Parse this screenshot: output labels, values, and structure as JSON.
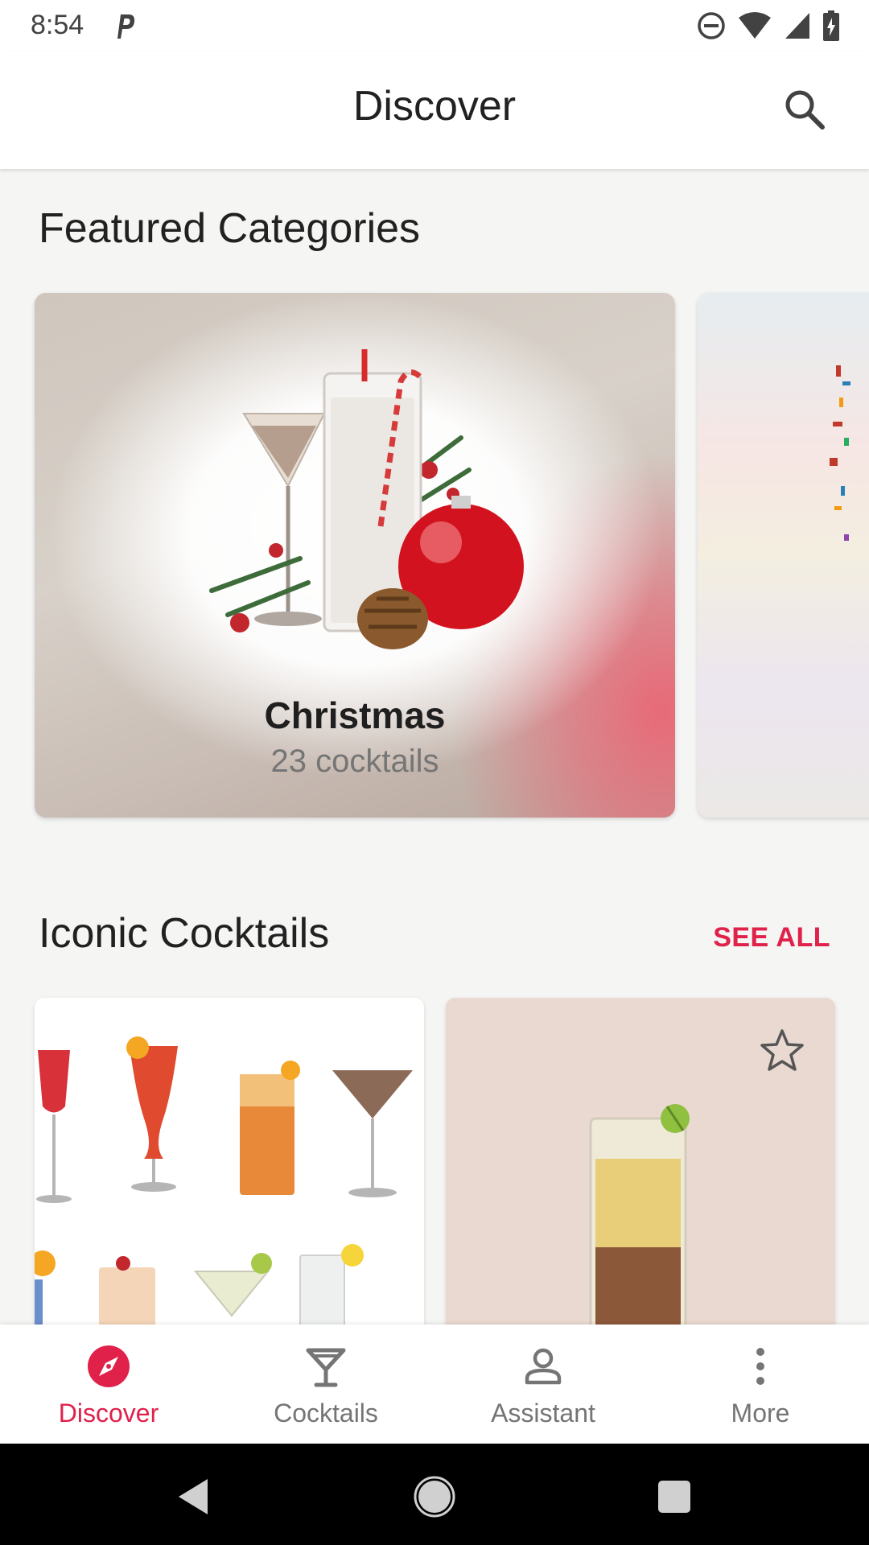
{
  "status_bar": {
    "time": "8:54",
    "icons": [
      "parking-notification-icon",
      "do-not-disturb-icon",
      "wifi-icon",
      "cell-signal-icon",
      "battery-charging-icon"
    ]
  },
  "app_bar": {
    "title": "Discover",
    "search_icon": "search-icon"
  },
  "featured": {
    "title": "Featured Categories",
    "cards": [
      {
        "name": "Christmas",
        "count": "23 cocktails"
      }
    ]
  },
  "iconic": {
    "title": "Iconic Cocktails",
    "see_all": "SEE ALL",
    "favorite_icon": "star-outline-icon"
  },
  "bottom_nav": {
    "items": [
      {
        "label": "Discover",
        "icon": "compass-icon",
        "active": true
      },
      {
        "label": "Cocktails",
        "icon": "cocktail-glass-icon",
        "active": false
      },
      {
        "label": "Assistant",
        "icon": "person-icon",
        "active": false
      },
      {
        "label": "More",
        "icon": "more-vertical-icon",
        "active": false
      }
    ]
  },
  "colors": {
    "accent": "#e0214a",
    "background": "#f5f5f4",
    "inactive": "#757575"
  }
}
